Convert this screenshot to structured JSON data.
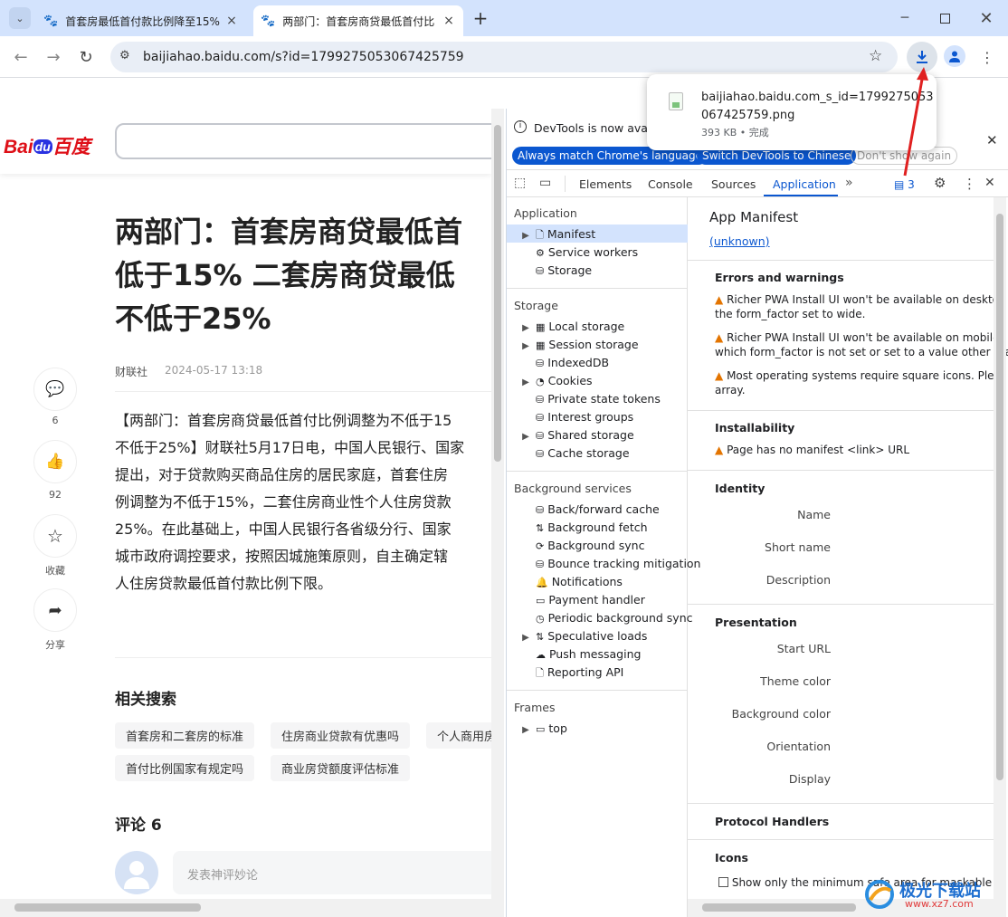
{
  "browser": {
    "tabs": [
      {
        "title": "首套房最低首付款比例降至15%"
      },
      {
        "title": "两部门：首套房商贷最低首付比"
      }
    ],
    "url": "baijiahao.baidu.com/s?id=1799275053067425759",
    "new_tab": "+"
  },
  "download": {
    "filename_line1": "baijiahao.baidu.com_s_id=1799275053",
    "filename_line2": "067425759.png",
    "status": "393 KB • 完成"
  },
  "article": {
    "logo": "Bai",
    "logo_cn": "百度",
    "title_lines": [
      "两部门：首套房商贷最低首",
      "低于15% 二套房商贷最低",
      "不低于25%"
    ],
    "source": "财联社",
    "date": "2024-05-17 13:18",
    "body_lines": [
      "【两部门：首套房商贷最低首付比例调整为不低于15",
      "不低于25%】财联社5月17日电，中国人民银行、国家",
      "提出，对于贷款购买商品住房的居民家庭，首套住房",
      "例调整为不低于15%，二套住房商业性个人住房贷款",
      "25%。在此基础上，中国人民银行各省级分行、国家",
      "城市政府调控要求，按照因城施策原则，自主确定辖",
      "人住房贷款最低首付款比例下限。"
    ],
    "side": {
      "comments": "6",
      "likes": "92",
      "collect": "收藏",
      "share": "分享"
    },
    "related_title": "相关搜索",
    "related": [
      "首套房和二套房的标准",
      "住房商业贷款有优惠吗",
      "个人商用房",
      "首付比例国家有规定吗",
      "商业房贷额度评估标准"
    ],
    "comments_title": "评论 6",
    "comment_placeholder": "发表神评妙论"
  },
  "devtools": {
    "banner_text": "DevTools is now avail",
    "banner_btn1": "Always match Chrome's language",
    "banner_btn2": "Switch DevTools to Chinese",
    "banner_btn3": "Don't show again",
    "tabs": [
      "Elements",
      "Console",
      "Sources",
      "Application"
    ],
    "issues_count": "3",
    "sidebar": {
      "app_header": "Application",
      "app_items": [
        "Manifest",
        "Service workers",
        "Storage"
      ],
      "storage_header": "Storage",
      "storage_items": [
        "Local storage",
        "Session storage",
        "IndexedDB",
        "Cookies",
        "Private state tokens",
        "Interest groups",
        "Shared storage",
        "Cache storage"
      ],
      "bg_header": "Background services",
      "bg_items": [
        "Back/forward cache",
        "Background fetch",
        "Background sync",
        "Bounce tracking mitigation",
        "Notifications",
        "Payment handler",
        "Periodic background sync",
        "Speculative loads",
        "Push messaging",
        "Reporting API"
      ],
      "frames_header": "Frames",
      "frames_items": [
        "top"
      ]
    },
    "manifest": {
      "title": "App Manifest",
      "link": "(unknown)",
      "errors_header": "Errors and warnings",
      "warnings": [
        [
          "Richer PWA Install UI won't be available on deskto",
          "the form_factor set to wide."
        ],
        [
          "Richer PWA Install UI won't be available on mobile",
          "which form_factor is not set or set to a value other tha"
        ],
        [
          "Most operating systems require square icons. Plea",
          "array."
        ]
      ],
      "install_header": "Installability",
      "install_warning": "Page has no manifest <link> URL",
      "identity_header": "Identity",
      "identity_fields": [
        "Name",
        "Short name",
        "Description"
      ],
      "presentation_header": "Presentation",
      "presentation_fields": [
        "Start URL",
        "Theme color",
        "Background color",
        "Orientation",
        "Display"
      ],
      "protocol_header": "Protocol Handlers",
      "icons_header": "Icons",
      "icons_checkbox": "Show only the minimum safe area for maskable ic"
    }
  },
  "watermark": {
    "text": "极光下载站",
    "url": "www.xz7.com"
  },
  "colors": {
    "accent": "#1a73e8",
    "warn": "#e37400",
    "arrow": "#e02020",
    "baidu_red": "#de0f17",
    "baidu_blue": "#2932e1"
  }
}
